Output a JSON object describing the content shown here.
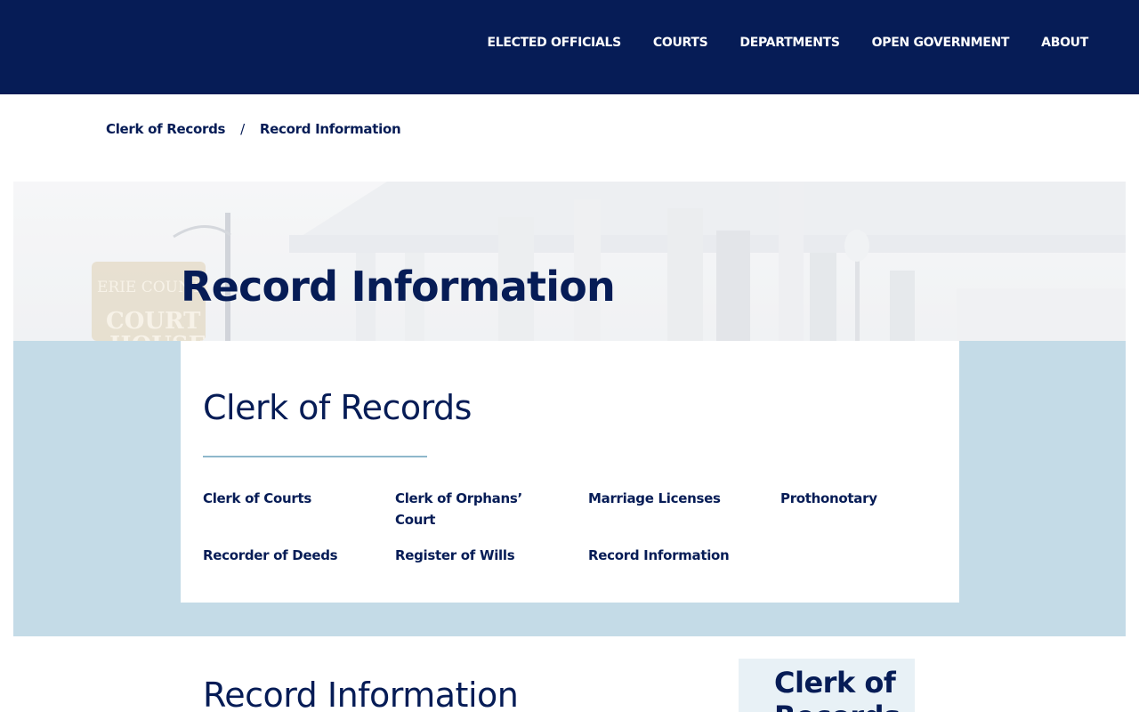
{
  "header": {
    "nav": [
      {
        "label": "ELECTED OFFICIALS"
      },
      {
        "label": "COURTS"
      },
      {
        "label": "DEPARTMENTS"
      },
      {
        "label": "OPEN GOVERNMENT"
      },
      {
        "label": "ABOUT"
      }
    ]
  },
  "breadcrumb": {
    "items": [
      "Clerk of Records",
      "Record Information"
    ],
    "separator": "/"
  },
  "hero": {
    "title": "Record Information",
    "sign_line1": "ERIE COUNTY",
    "sign_line2": "COURT",
    "sign_line3": "HOUSE"
  },
  "clerk": {
    "title": "Clerk of Records",
    "links": [
      "Clerk of Courts",
      "Clerk of Orphans’ Court",
      "Marriage Licenses",
      "Prothonotary",
      "Recorder of Deeds",
      "Register of Wills",
      "Record Information"
    ]
  },
  "main": {
    "heading": "Record Information",
    "side_box_title": "Clerk of Records"
  },
  "colors": {
    "navy": "#061c56",
    "band": "#c4dbe7",
    "rule": "#8fb8cb"
  }
}
